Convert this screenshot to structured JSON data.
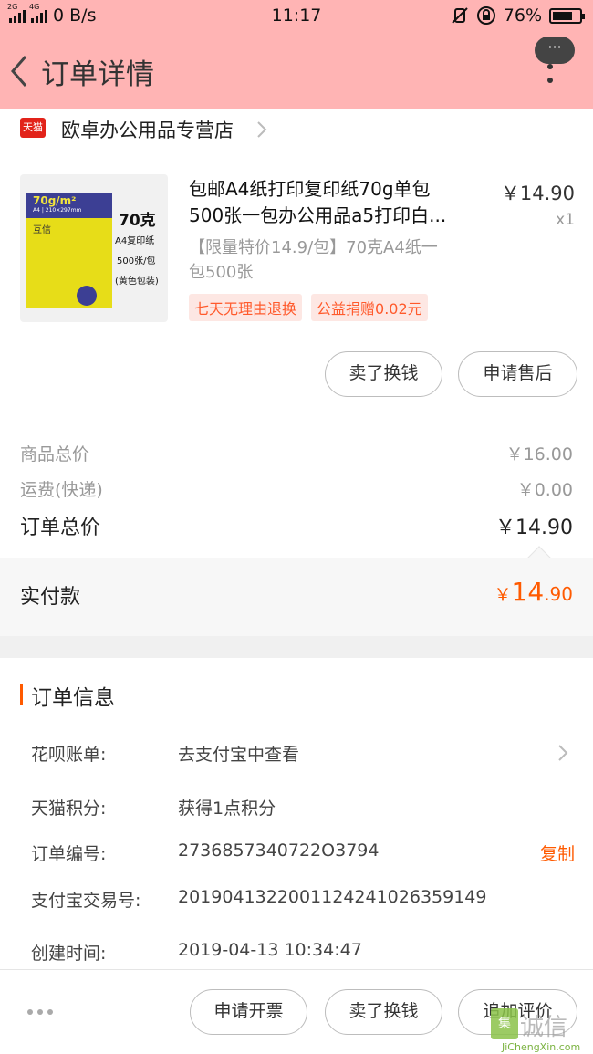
{
  "status_bar": {
    "net_small_1": "2G",
    "net_small_2": "4G",
    "speed": "0 B/s",
    "time": "11:17",
    "battery": "76%",
    "battery_level": 0.76
  },
  "header": {
    "title": "订单详情",
    "more_bubble": "···"
  },
  "shop": {
    "badge": "天猫",
    "name": "欧卓办公用品专营店"
  },
  "product": {
    "image_text": {
      "weight": "70克",
      "line1": "A4复印纸",
      "line2": "500张/包",
      "line3": "(黄色包装)",
      "pack_grammage": "70g/m²",
      "pack_size": "A4 | 210×297mm",
      "pack_brand": "互信"
    },
    "title_line1": "包邮A4纸打印复印纸70g单包",
    "title_line2": "500张一包办公用品a5打印白...",
    "price": "￥14.90",
    "qty": "x1",
    "sku_line1": "【限量特价14.9/包】70克A4纸一",
    "sku_line2": "包500张",
    "tags": [
      "七天无理由退换",
      "公益捐赠0.02元"
    ],
    "actions": {
      "sell": "卖了换钱",
      "after_sale": "申请售后"
    }
  },
  "summary": {
    "goods_label": "商品总价",
    "goods_value": "￥16.00",
    "shipping_label": "运费(快递)",
    "shipping_value": "￥0.00",
    "total_label": "订单总价",
    "total_value": "￥14.90",
    "paid_label": "实付款",
    "paid_symbol": "￥",
    "paid_int": "14",
    "paid_dec": ".90"
  },
  "order_info": {
    "title": "订单信息",
    "rows": [
      {
        "label": "花呗账单:",
        "value": "去支付宝中查看"
      },
      {
        "label": "天猫积分:",
        "value": "获得1点积分"
      },
      {
        "label": "订单编号:",
        "value": "2736857340722O3794",
        "action": "复制"
      },
      {
        "label": "支付宝交易号:",
        "value": "2019041322001124241026359149"
      },
      {
        "label": "创建时间:",
        "value": "2019-04-13 10:34:47"
      }
    ]
  },
  "bottom_bar": {
    "invoice": "申请开票",
    "sell": "卖了换钱",
    "review": "追加评价"
  },
  "watermark": {
    "logo": "集",
    "text": "诚信",
    "url": "JiChengXin.com"
  },
  "colors": {
    "header_bg": "#ffb4b4",
    "accent": "#ff5a00",
    "tag_bg": "#fde7e3",
    "tag_text": "#ff5a2c"
  }
}
